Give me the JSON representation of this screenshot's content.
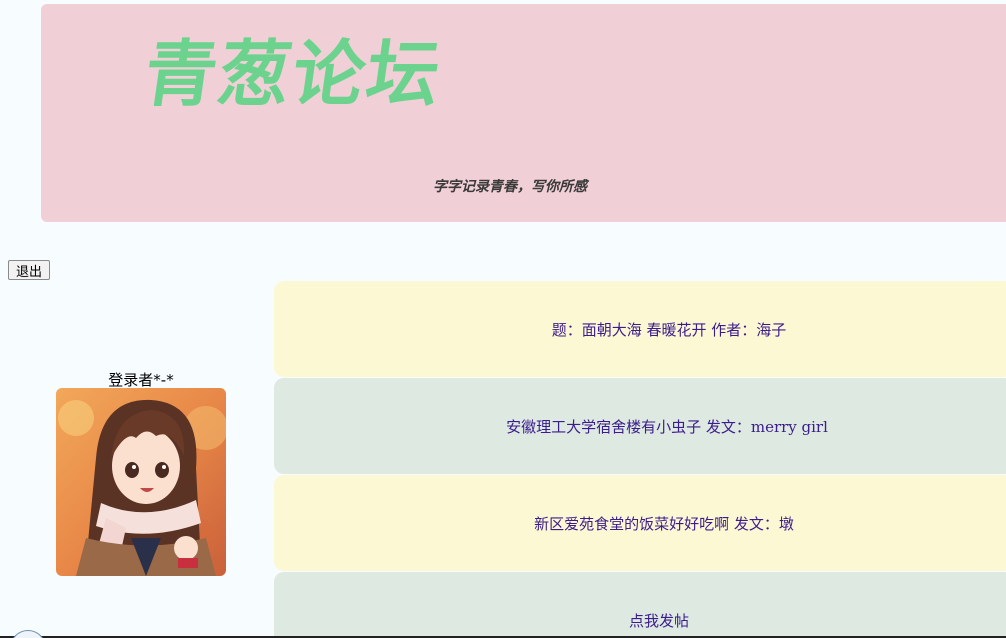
{
  "header": {
    "logo_text": "青葱论坛",
    "slogan": "字字记录青春，写你所感"
  },
  "actions": {
    "logout_label": "退出"
  },
  "user": {
    "label": "登录者*-*"
  },
  "posts": [
    {
      "text": "题：面朝大海 春暖花开 作者：海子"
    },
    {
      "text": "安徽理工大学宿舍楼有小虫子 发文：merry girl"
    },
    {
      "text": "新区爱苑食堂的饭菜好好吃啊 发文：墩"
    },
    {
      "text": "点我发帖"
    }
  ],
  "colors": {
    "page_bg": "#f7fcff",
    "header_bg": "#f0d0d6",
    "logo_color": "#6cd38e",
    "post_yellow": "#fdf8d4",
    "post_green": "#dde9e1",
    "post_text": "#3b1c8c"
  }
}
